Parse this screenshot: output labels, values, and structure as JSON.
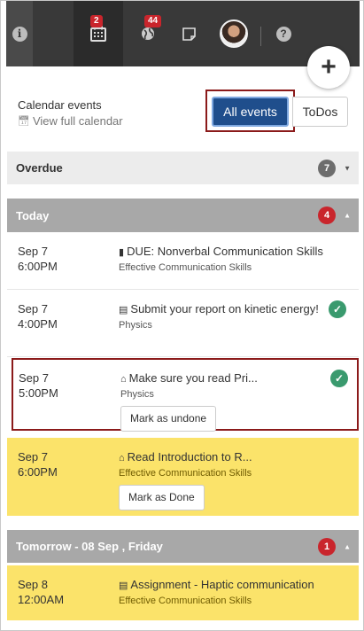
{
  "topbar": {
    "calendar_badge": "2",
    "globe_badge": "44"
  },
  "header": {
    "calendar_events": "Calendar events",
    "view_full_calendar": "View full calendar",
    "all_events": "All events",
    "todos": "ToDos"
  },
  "overdue": {
    "label": "Overdue",
    "count": "7"
  },
  "today": {
    "label": "Today",
    "count": "4"
  },
  "tomorrow": {
    "label": "Tomorrow - 08 Sep , Friday",
    "count": "1"
  },
  "events": [
    {
      "date": "Sep 7",
      "time": "6:00PM",
      "title": "DUE: Nonverbal Communication Skills",
      "course": "Effective Communication Skills",
      "icon": "book-icon"
    },
    {
      "date": "Sep 7",
      "time": "4:00PM",
      "title": "Submit your report on kinetic energy!",
      "course": "Physics",
      "icon": "assignment-icon",
      "done": true
    },
    {
      "date": "Sep 7",
      "time": "5:00PM",
      "title": "Make sure you read Pri...",
      "course": "Physics",
      "icon": "home-icon",
      "done": true,
      "button": "Mark as undone"
    },
    {
      "date": "Sep 7",
      "time": "6:00PM",
      "title": "Read Introduction to R...",
      "course": "Effective Communication Skills",
      "icon": "home-icon",
      "button": "Mark as Done"
    },
    {
      "date": "Sep 8",
      "time": "12:00AM",
      "title": "Assignment - Haptic communication",
      "course": "Effective Communication Skills",
      "icon": "assignment-icon"
    }
  ],
  "colors": {
    "topbar": "#393939",
    "primary_button": "#1f4e8c",
    "badge_red": "#c9252c",
    "done_green": "#3a9a6e",
    "highlight_yellow": "#fbe36a"
  }
}
